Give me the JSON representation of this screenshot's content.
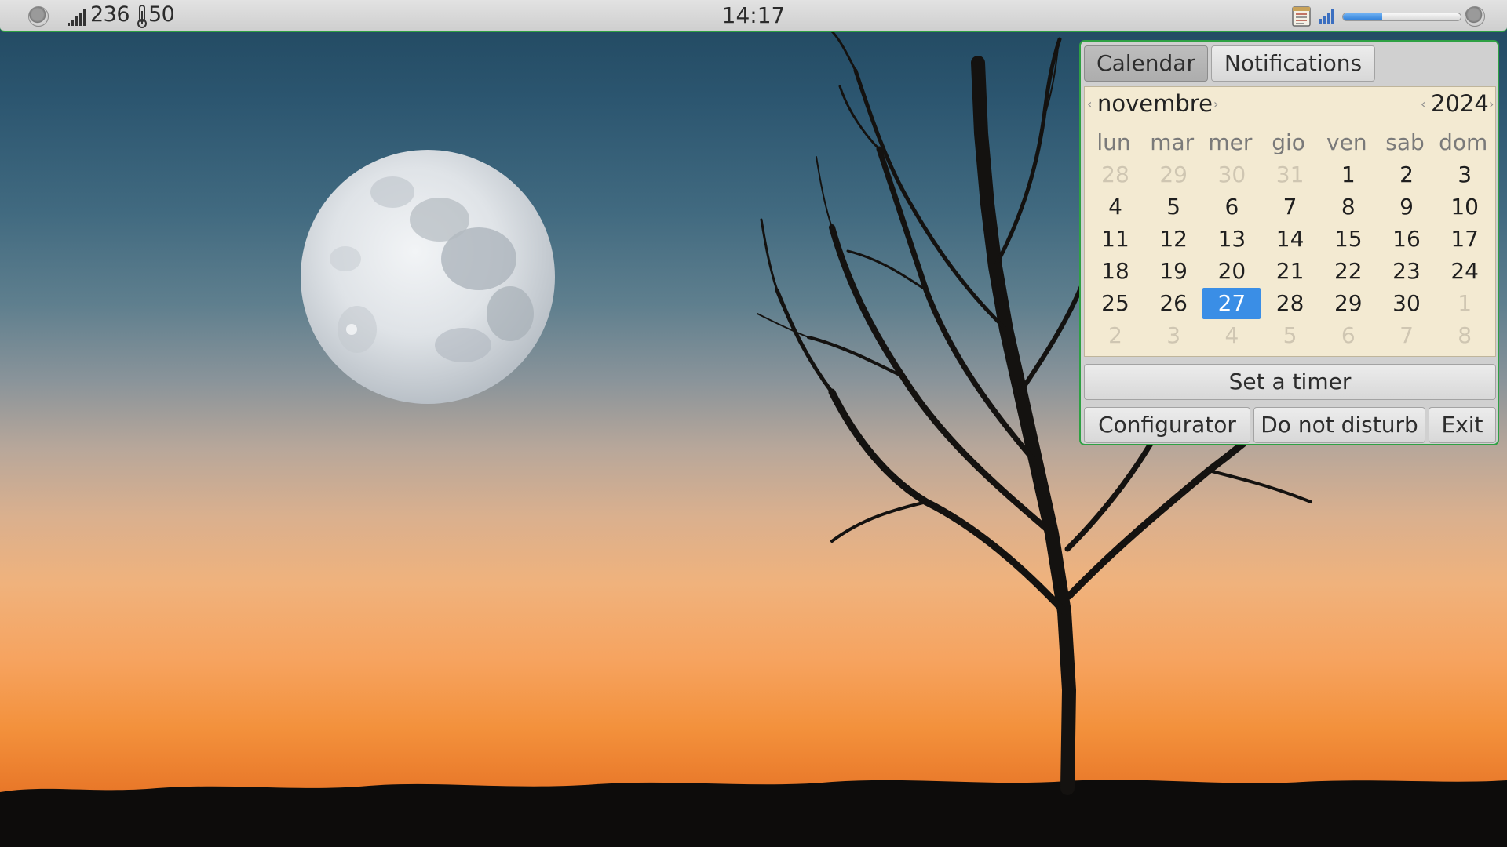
{
  "top_panel": {
    "signal_value": "236",
    "temperature_value": "50",
    "clock": "14:17",
    "volume_level": 0.33
  },
  "popup": {
    "tabs": {
      "calendar": "Calendar",
      "notifications": "Notifications"
    },
    "calendar": {
      "month": "novembre",
      "year": "2024",
      "weekdays": [
        "lun",
        "mar",
        "mer",
        "gio",
        "ven",
        "sab",
        "dom"
      ],
      "weeks": [
        [
          "28",
          "29",
          "30",
          "31",
          "1",
          "2",
          "3"
        ],
        [
          "4",
          "5",
          "6",
          "7",
          "8",
          "9",
          "10"
        ],
        [
          "11",
          "12",
          "13",
          "14",
          "15",
          "16",
          "17"
        ],
        [
          "18",
          "19",
          "20",
          "21",
          "22",
          "23",
          "24"
        ],
        [
          "25",
          "26",
          "27",
          "28",
          "29",
          "30",
          "1"
        ],
        [
          "2",
          "3",
          "4",
          "5",
          "6",
          "7",
          "8"
        ]
      ],
      "selected_day": "27"
    },
    "buttons": {
      "timer": "Set a timer",
      "configurator": "Configurator",
      "do_not_disturb": "Do not disturb",
      "exit": "Exit"
    }
  },
  "colors": {
    "panel_border": "#2ea043",
    "calendar_bg": "#f3ead2",
    "selected_day_bg": "#3a8ee6"
  }
}
